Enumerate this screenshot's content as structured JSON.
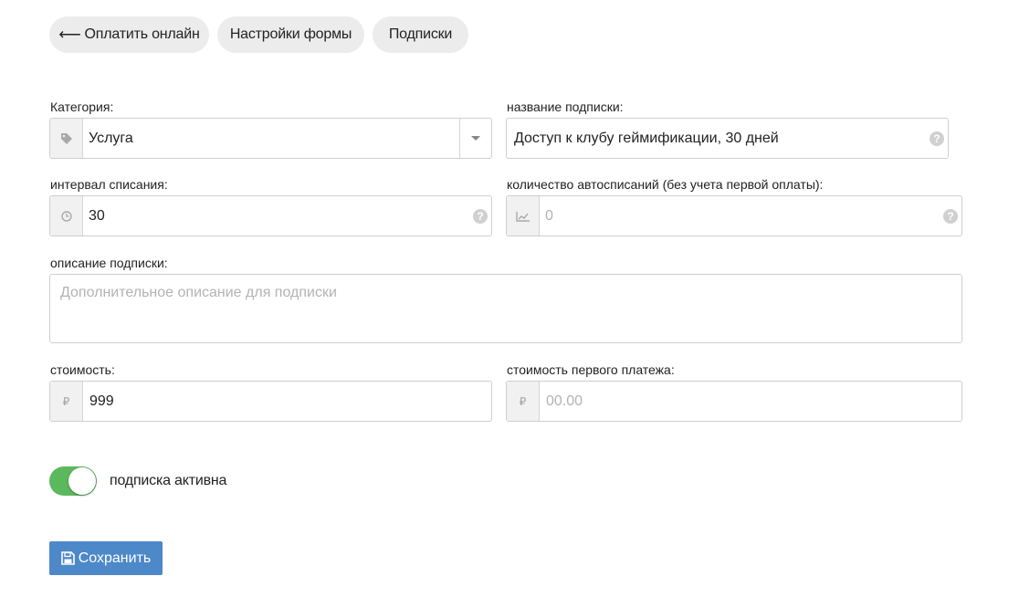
{
  "tabs": [
    {
      "label": "Оплатить онлайн",
      "arrow": "⟵"
    },
    {
      "label": "Настройки формы"
    },
    {
      "label": "Подписки"
    }
  ],
  "form": {
    "category": {
      "label": "Категория:",
      "value": "Услуга",
      "icon": "tag-icon"
    },
    "subscription_name": {
      "label": "название подписки:",
      "value": "Доступ к клубу геймификации, 30 дней"
    },
    "interval": {
      "label": "интервал списания:",
      "value": "30",
      "icon": "clock-icon"
    },
    "autocharges": {
      "label": "количество автосписаний (без учета первой оплаты):",
      "placeholder": "0",
      "icon": "chart-icon"
    },
    "description": {
      "label": "описание подписки:",
      "placeholder": "Дополнительное описание для подписки"
    },
    "price": {
      "label": "стоимость:",
      "value": "999",
      "currency": "₽"
    },
    "first_payment": {
      "label": "стоимость первого платежа:",
      "placeholder": "00.00",
      "currency": "₽"
    },
    "active_toggle": {
      "label": "подписка активна",
      "on": true,
      "color": "#5cb85c"
    }
  },
  "save_button": {
    "label": "Сохранить",
    "icon": "floppy-disk-icon",
    "color": "#4d88c9"
  },
  "help_glyph": "?"
}
